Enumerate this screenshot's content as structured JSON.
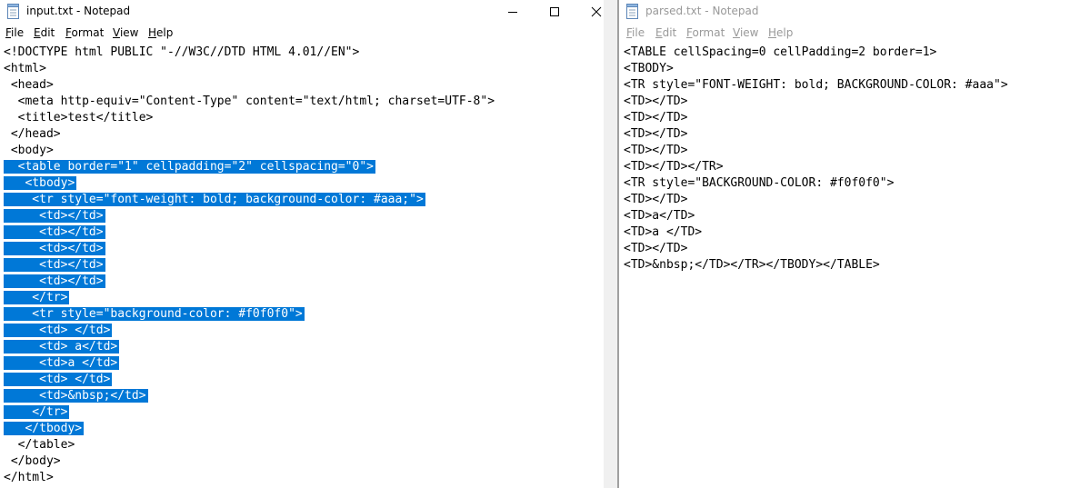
{
  "left_window": {
    "title": "input.txt - Notepad",
    "menu": [
      "File",
      "Edit",
      "Format",
      "View",
      "Help"
    ],
    "lines": [
      {
        "text": "<!DOCTYPE html PUBLIC \"-//W3C//DTD HTML 4.01//EN\">",
        "selected": false
      },
      {
        "text": "<html>",
        "selected": false
      },
      {
        "text": " <head>",
        "selected": false
      },
      {
        "text": "  <meta http-equiv=\"Content-Type\" content=\"text/html; charset=UTF-8\">",
        "selected": false
      },
      {
        "text": "  <title>test</title>",
        "selected": false
      },
      {
        "text": " </head>",
        "selected": false
      },
      {
        "text": " <body>",
        "selected": false
      },
      {
        "text": "  <table border=\"1\" cellpadding=\"2\" cellspacing=\"0\">",
        "selected": true
      },
      {
        "text": "   <tbody>",
        "selected": true
      },
      {
        "text": "    <tr style=\"font-weight: bold; background-color: #aaa;\">",
        "selected": true
      },
      {
        "text": "     <td></td>",
        "selected": true
      },
      {
        "text": "     <td></td>",
        "selected": true
      },
      {
        "text": "     <td></td>",
        "selected": true
      },
      {
        "text": "     <td></td>",
        "selected": true
      },
      {
        "text": "     <td></td>",
        "selected": true
      },
      {
        "text": "    </tr>",
        "selected": true
      },
      {
        "text": "    <tr style=\"background-color: #f0f0f0\">",
        "selected": true
      },
      {
        "text": "     <td> </td>",
        "selected": true
      },
      {
        "text": "     <td> a</td>",
        "selected": true
      },
      {
        "text": "     <td>a </td>",
        "selected": true
      },
      {
        "text": "     <td> </td>",
        "selected": true
      },
      {
        "text": "     <td>&nbsp;</td>",
        "selected": true
      },
      {
        "text": "    </tr>",
        "selected": true
      },
      {
        "text": "   </tbody>",
        "selected": true
      },
      {
        "text": "  </table>",
        "selected": false
      },
      {
        "text": " </body>",
        "selected": false
      },
      {
        "text": "</html>",
        "selected": false
      }
    ]
  },
  "right_window": {
    "title": "parsed.txt - Notepad",
    "menu": [
      "File",
      "Edit",
      "Format",
      "View",
      "Help"
    ],
    "lines": [
      {
        "text": "<TABLE cellSpacing=0 cellPadding=2 border=1>",
        "selected": false
      },
      {
        "text": "<TBODY>",
        "selected": false
      },
      {
        "text": "<TR style=\"FONT-WEIGHT: bold; BACKGROUND-COLOR: #aaa\">",
        "selected": false
      },
      {
        "text": "<TD></TD>",
        "selected": false
      },
      {
        "text": "<TD></TD>",
        "selected": false
      },
      {
        "text": "<TD></TD>",
        "selected": false
      },
      {
        "text": "<TD></TD>",
        "selected": false
      },
      {
        "text": "<TD></TD></TR>",
        "selected": false
      },
      {
        "text": "<TR style=\"BACKGROUND-COLOR: #f0f0f0\">",
        "selected": false
      },
      {
        "text": "<TD></TD>",
        "selected": false
      },
      {
        "text": "<TD>a</TD>",
        "selected": false
      },
      {
        "text": "<TD>a </TD>",
        "selected": false
      },
      {
        "text": "<TD></TD>",
        "selected": false
      },
      {
        "text": "<TD>&nbsp;</TD></TR></TBODY></TABLE>",
        "selected": false
      }
    ]
  },
  "colors": {
    "selection": "#0078d7",
    "selection_text": "#ffffff",
    "inactive_text": "#999999"
  },
  "icons": [
    "notepad-icon",
    "minimize-icon",
    "maximize-icon",
    "close-icon"
  ]
}
